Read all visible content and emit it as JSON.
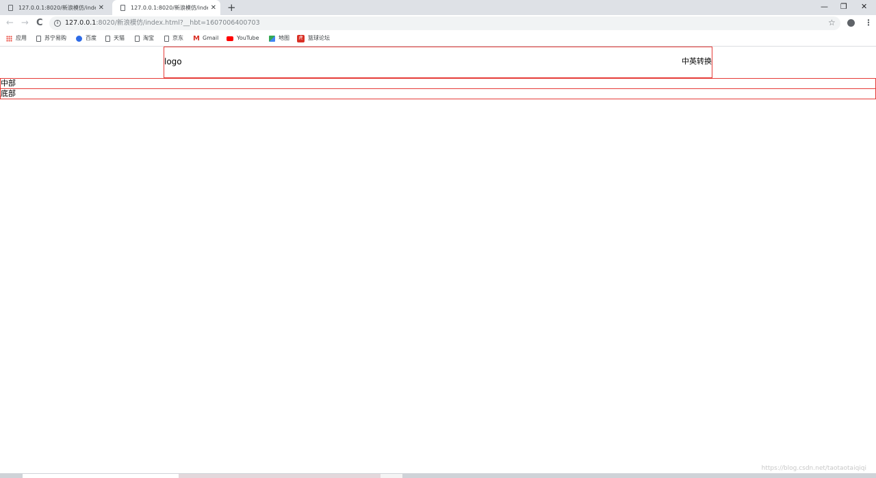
{
  "browser": {
    "tabs": [
      {
        "title": "127.0.0.1:8020/新浪模仿/index",
        "close": "✕"
      },
      {
        "title": "127.0.0.1:8020/新浪模仿/index",
        "close": "✕"
      }
    ],
    "new_tab": "+",
    "window_controls": {
      "minimize": "—",
      "restore": "❐",
      "close": "✕"
    },
    "nav": {
      "back": "←",
      "forward": "→",
      "reload": "C"
    },
    "url_host": "127.0.0.1",
    "url_rest": ":8020/新浪模仿/index.html?__hbt=1607006400703",
    "bookmarks": [
      {
        "label": "应用",
        "icon": "apps-icon"
      },
      {
        "label": "苏宁易购",
        "icon": "page-icon"
      },
      {
        "label": "百度",
        "icon": "baidu-paw-icon"
      },
      {
        "label": "天猫",
        "icon": "page-icon"
      },
      {
        "label": "淘宝",
        "icon": "page-icon"
      },
      {
        "label": "京东",
        "icon": "page-icon"
      },
      {
        "label": "Gmail",
        "icon": "gmail-icon"
      },
      {
        "label": "YouTube",
        "icon": "youtube-icon"
      },
      {
        "label": "地图",
        "icon": "maps-icon"
      },
      {
        "label": "篮球论坛",
        "icon": "basketball-forum-icon"
      }
    ]
  },
  "page": {
    "header": {
      "logo": "logo",
      "language_switch": "中英转换"
    },
    "middle": "中部",
    "bottom": "底部"
  },
  "watermark": "https://blog.csdn.net/taotaotaiqiqi",
  "colors": {
    "border": "#e53935",
    "tabstrip": "#dee1e6",
    "omnibox": "#f1f3f4"
  }
}
